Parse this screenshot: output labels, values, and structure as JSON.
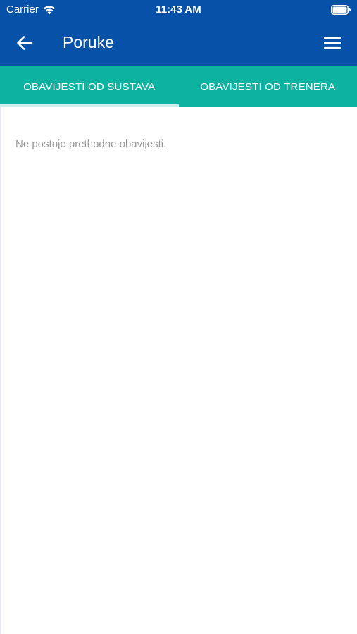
{
  "status_bar": {
    "carrier": "Carrier",
    "time": "11:43 AM",
    "wifi_icon": "wifi-icon",
    "battery_icon": "battery-icon"
  },
  "header": {
    "title": "Poruke",
    "back_icon": "arrow-left-icon",
    "menu_icon": "hamburger-menu-icon",
    "background_color": "#0751a8"
  },
  "tabs": [
    {
      "label": "OBAVIJESTI OD SUSTAVA",
      "active": true
    },
    {
      "label": "OBAVIJESTI OD TRENERA",
      "active": false
    }
  ],
  "tab_bar_color": "#0db3a0",
  "content": {
    "empty_message": "Ne postoje prethodne obavijesti."
  }
}
